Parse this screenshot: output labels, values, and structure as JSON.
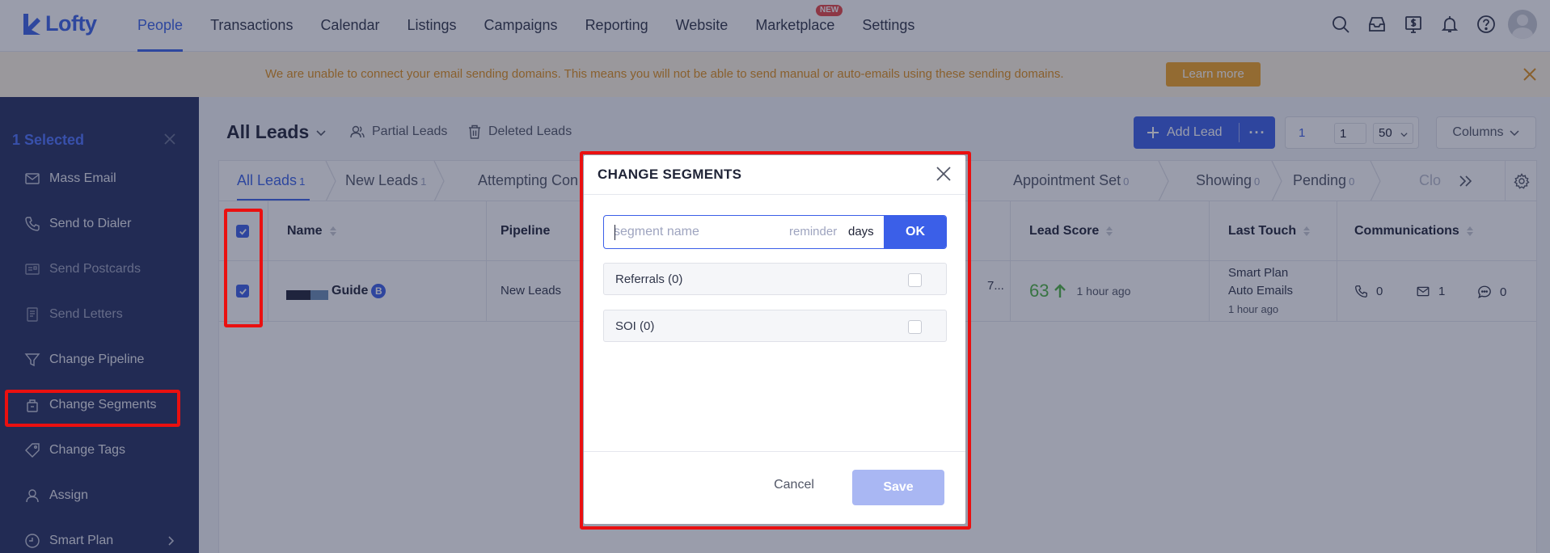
{
  "app": {
    "logo_text": "Lofty"
  },
  "nav": {
    "items": [
      {
        "label": "People",
        "active": true
      },
      {
        "label": "Transactions"
      },
      {
        "label": "Calendar"
      },
      {
        "label": "Listings"
      },
      {
        "label": "Campaigns"
      },
      {
        "label": "Reporting"
      },
      {
        "label": "Website"
      },
      {
        "label": "Marketplace",
        "badge": "NEW"
      },
      {
        "label": "Settings"
      }
    ],
    "icons": [
      "search-icon",
      "inbox-icon",
      "dollar-icon",
      "bell-icon",
      "help-icon",
      "avatar"
    ]
  },
  "banner": {
    "message": "We are unable to connect your email sending domains. This means you will not be able to send manual or auto-emails using these sending domains.",
    "button_label": "Learn more"
  },
  "sidebar": {
    "selected_label": "1 Selected",
    "items": [
      {
        "label": "Mass Email",
        "icon": "mail-icon"
      },
      {
        "label": "Send to Dialer",
        "icon": "phone-icon"
      },
      {
        "label": "Send Postcards",
        "icon": "postcard-icon",
        "dim": true
      },
      {
        "label": "Send Letters",
        "icon": "letter-icon",
        "dim": true
      },
      {
        "label": "Change Pipeline",
        "icon": "funnel-icon"
      },
      {
        "label": "Change Segments",
        "icon": "segment-icon"
      },
      {
        "label": "Change Tags",
        "icon": "tag-icon"
      },
      {
        "label": "Assign",
        "icon": "user-icon"
      },
      {
        "label": "Smart Plan",
        "icon": "smartplan-icon"
      }
    ]
  },
  "header": {
    "title": "All Leads",
    "partial_leads": "Partial Leads",
    "deleted_leads": "Deleted Leads",
    "add_lead": "Add Lead",
    "add_more": "···",
    "page_current": "1",
    "page_input": "1",
    "per_page": "50",
    "columns": "Columns"
  },
  "stages": [
    {
      "label": "All Leads",
      "count": "1",
      "active": true
    },
    {
      "label": "New Leads",
      "count": "1"
    },
    {
      "label": "Attempting Con",
      "count": ""
    },
    {
      "label": "Appointment Set",
      "count": "0"
    },
    {
      "label": "Showing",
      "count": "0"
    },
    {
      "label": "Pending",
      "count": "0"
    },
    {
      "label": "Clo",
      "count": ""
    }
  ],
  "table": {
    "columns": [
      "Name",
      "Pipeline",
      "Lead Score",
      "Last Touch",
      "Communications"
    ],
    "rows": [
      {
        "name": "Guide",
        "name_badge": "B",
        "pipeline": "New Leads",
        "partial": "7...",
        "lead_score": "63",
        "lead_score_ago": "1 hour ago",
        "last_touch_line1": "Smart Plan",
        "last_touch_line2": "Auto Emails",
        "last_touch_time": "1 hour ago",
        "calls": "0",
        "emails": "1",
        "texts": "0"
      }
    ]
  },
  "modal": {
    "title": "CHANGE SEGMENTS",
    "segment_placeholder": "segment name",
    "reminder": "reminder",
    "days": "days",
    "ok": "OK",
    "options": [
      "Referrals (0)",
      "SOI (0)"
    ],
    "cancel": "Cancel",
    "save": "Save"
  },
  "colors": {
    "accent": "#3b5fe8",
    "highlight": "#ea1010",
    "sidebar_bg": "#263161",
    "banner_text": "#e0901c"
  }
}
